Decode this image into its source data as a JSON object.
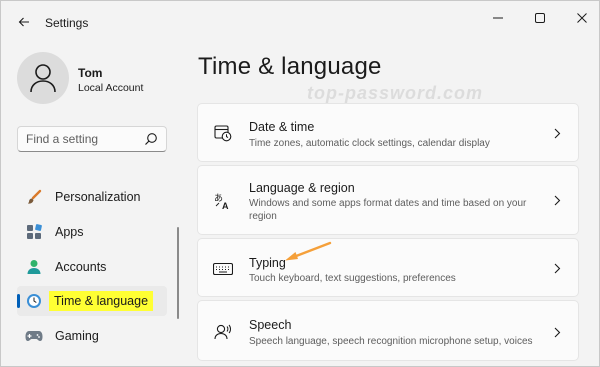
{
  "titlebar": {
    "title": "Settings"
  },
  "user": {
    "name": "Tom",
    "account_type": "Local Account"
  },
  "search": {
    "placeholder": "Find a setting"
  },
  "watermark": "top-password.com",
  "nav": {
    "items": [
      {
        "label": "Personalization",
        "icon": "paintbrush-icon"
      },
      {
        "label": "Apps",
        "icon": "apps-icon"
      },
      {
        "label": "Accounts",
        "icon": "accounts-icon"
      },
      {
        "label": "Time & language",
        "icon": "time-language-icon",
        "selected": true
      },
      {
        "label": "Gaming",
        "icon": "gaming-icon"
      }
    ]
  },
  "main": {
    "title": "Time & language",
    "cards": [
      {
        "title": "Date & time",
        "description": "Time zones, automatic clock settings, calendar display",
        "icon": "calendar-clock-icon"
      },
      {
        "title": "Language & region",
        "description": "Windows and some apps format dates and time based on your region",
        "icon": "language-icon"
      },
      {
        "title": "Typing",
        "description": "Touch keyboard, text suggestions, preferences",
        "icon": "keyboard-icon"
      },
      {
        "title": "Speech",
        "description": "Speech language, speech recognition microphone setup, voices",
        "icon": "speech-icon"
      }
    ]
  },
  "colors": {
    "accent": "#005fb8",
    "highlight": "#ffff33",
    "annotation_arrow": "#f5a03a"
  }
}
